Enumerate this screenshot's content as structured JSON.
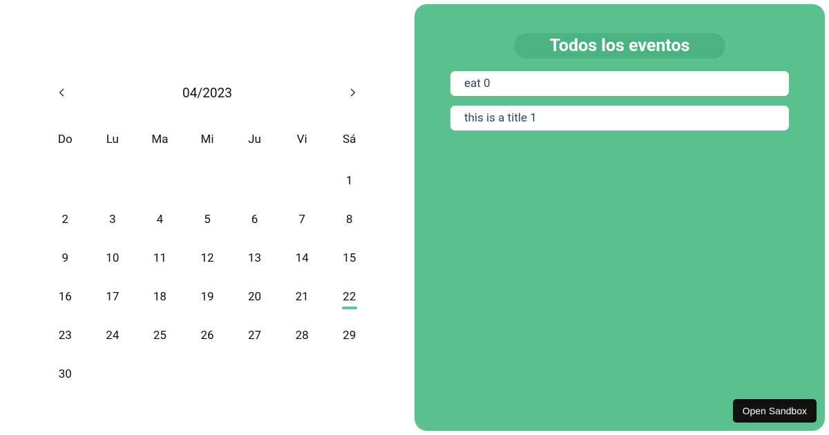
{
  "calendar": {
    "month_label": "04/2023",
    "days_of_week": [
      "Do",
      "Lu",
      "Ma",
      "Mi",
      "Ju",
      "Vi",
      "Sá"
    ],
    "leading_blanks": 6,
    "days_in_month": 30,
    "marked_day": 22
  },
  "events_panel": {
    "title": "Todos los eventos",
    "items": [
      {
        "title": "eat 0"
      },
      {
        "title": "this is a title 1"
      }
    ]
  },
  "sandbox_button_label": "Open Sandbox"
}
